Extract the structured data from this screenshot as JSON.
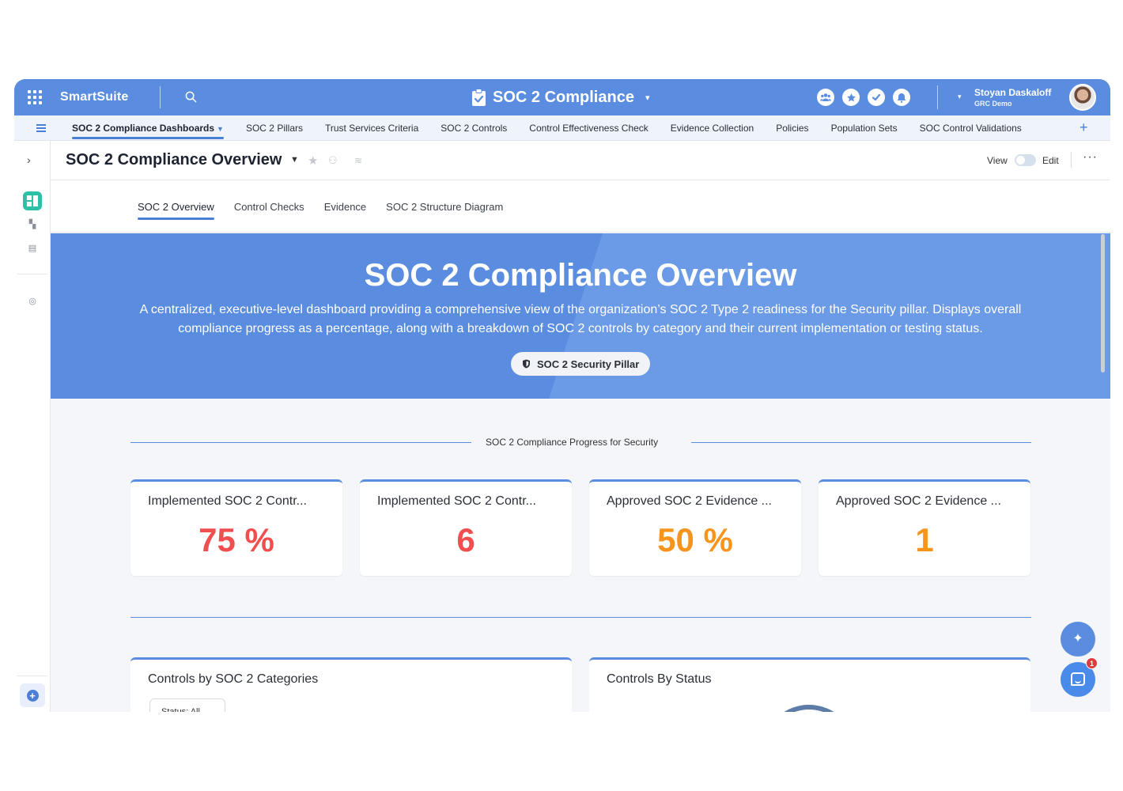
{
  "topbar": {
    "brand": "SmartSuite",
    "workspace_title": "SOC 2 Compliance",
    "user_name": "Stoyan Daskaloff",
    "user_org": "GRC Demo",
    "colors": {
      "bar": "#5a8de0"
    },
    "icons": [
      "apps-grid-icon",
      "search-icon",
      "clipboard-check-icon",
      "team-icon",
      "star-icon",
      "check-icon",
      "bell-icon"
    ]
  },
  "appnav": {
    "items": [
      {
        "label": "SOC 2 Compliance Dashboards",
        "active": true
      },
      {
        "label": "SOC 2 Pillars"
      },
      {
        "label": "Trust Services Criteria"
      },
      {
        "label": "SOC 2 Controls"
      },
      {
        "label": "Control Effectiveness Check"
      },
      {
        "label": "Evidence Collection"
      },
      {
        "label": "Policies"
      },
      {
        "label": "Population Sets"
      },
      {
        "label": "SOC Control Validations"
      }
    ],
    "add_label": "+"
  },
  "dashboard": {
    "title": "SOC 2 Compliance Overview",
    "view_label": "View",
    "edit_label": "Edit",
    "more_label": "···",
    "tabs": [
      {
        "label": "SOC 2 Overview",
        "active": true
      },
      {
        "label": "Control Checks"
      },
      {
        "label": "Evidence"
      },
      {
        "label": "SOC 2 Structure Diagram"
      }
    ]
  },
  "hero": {
    "title": "SOC 2 Compliance Overview",
    "description": "A centralized, executive-level dashboard providing a comprehensive view of the organization’s SOC 2 Type 2 readiness for the Security pillar. Displays overall compliance progress as a percentage, along with a breakdown of SOC 2 controls by category and their current implementation or testing status.",
    "pill_label": "SOC 2 Security Pillar"
  },
  "section": {
    "title": "SOC 2 Compliance Progress for Security"
  },
  "kpis": [
    {
      "label": "Implemented SOC 2 Contr...",
      "value": "75 %",
      "color": "#f04f4f"
    },
    {
      "label": "Implemented SOC 2 Contr...",
      "value": "6",
      "color": "#f04f4f"
    },
    {
      "label": "Approved SOC 2 Evidence ...",
      "value": "50 %",
      "color": "#f7941d"
    },
    {
      "label": "Approved SOC 2 Evidence ...",
      "value": "1",
      "color": "#f7941d"
    }
  ],
  "panels": {
    "categories": {
      "title": "Controls by SOC 2 Categories",
      "filter_label": "Status: All ⌄"
    },
    "status": {
      "title": "Controls By Status"
    }
  },
  "fab": {
    "ai_label": "✦",
    "chat_badge": "1"
  }
}
